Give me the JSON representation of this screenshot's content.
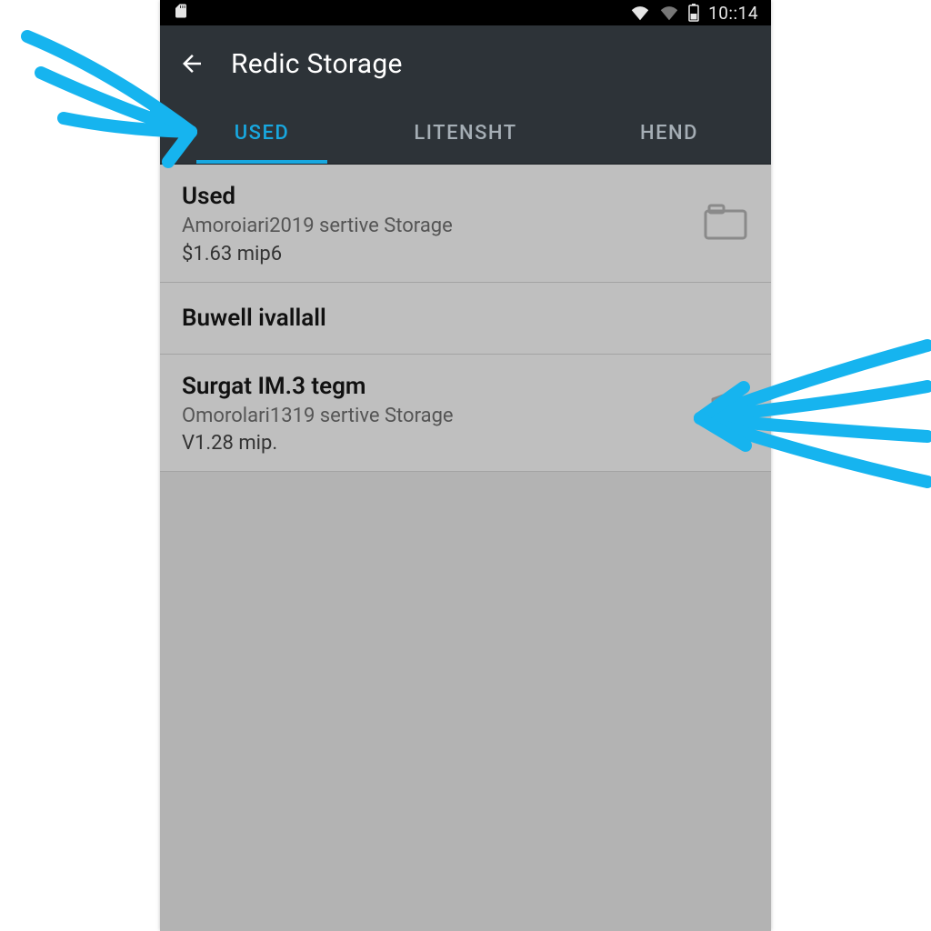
{
  "status_bar": {
    "time": "10::14"
  },
  "app_bar": {
    "title": "Redic Storage"
  },
  "tabs": [
    {
      "label": "USED",
      "active": true
    },
    {
      "label": "LITENSHT",
      "active": false
    },
    {
      "label": "HEND",
      "active": false
    }
  ],
  "items": [
    {
      "title": "Used",
      "subtitle": "Amoroiari2019 sertive Storage",
      "meta": "$1.63 mip6",
      "icon": "folder"
    },
    {
      "title": "Buwell ivallall"
    },
    {
      "title": "Surgat IM.3 tegm",
      "subtitle": "Omorolari1319 sertive Storage",
      "meta": "V1.28 mip.",
      "icon": "shield"
    }
  ]
}
